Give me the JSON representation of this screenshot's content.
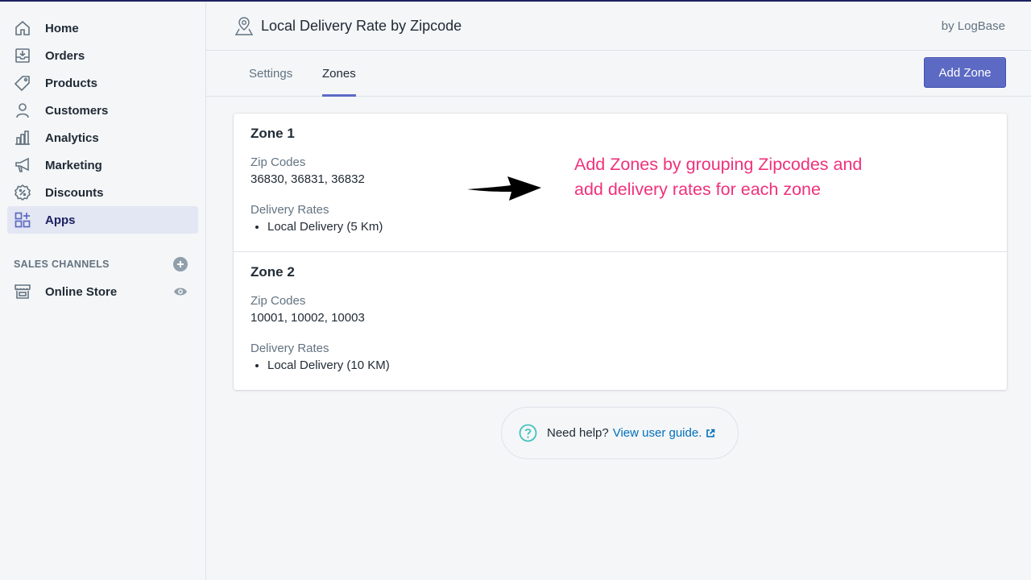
{
  "sidebar": {
    "items": [
      {
        "label": "Home",
        "icon": "home-icon"
      },
      {
        "label": "Orders",
        "icon": "orders-icon"
      },
      {
        "label": "Products",
        "icon": "tag-icon"
      },
      {
        "label": "Customers",
        "icon": "person-icon"
      },
      {
        "label": "Analytics",
        "icon": "bar-chart-icon"
      },
      {
        "label": "Marketing",
        "icon": "megaphone-icon"
      },
      {
        "label": "Discounts",
        "icon": "discount-icon"
      },
      {
        "label": "Apps",
        "icon": "apps-grid-icon",
        "active": true
      }
    ],
    "sales_channels": {
      "heading": "SALES CHANNELS",
      "online_store": "Online Store"
    }
  },
  "header": {
    "title": "Local Delivery Rate by Zipcode",
    "by": "by LogBase"
  },
  "tabs": [
    {
      "label": "Settings"
    },
    {
      "label": "Zones",
      "active": true
    }
  ],
  "add_zone_label": "Add Zone",
  "zones": [
    {
      "title": "Zone 1",
      "zip_label": "Zip Codes",
      "zips": "36830, 36831, 36832",
      "rates_label": "Delivery Rates",
      "rates": [
        "Local Delivery (5 Km)"
      ]
    },
    {
      "title": "Zone 2",
      "zip_label": "Zip Codes",
      "zips": "10001, 10002, 10003",
      "rates_label": "Delivery Rates",
      "rates": [
        "Local Delivery (10 KM)"
      ]
    }
  ],
  "annotation": "Add Zones by grouping Zipcodes and add delivery rates for each zone",
  "help": {
    "text": "Need help?",
    "link": "View user guide."
  },
  "colors": {
    "accent": "#5c6ac4",
    "annotation": "#f0317a",
    "link": "#006fbb"
  }
}
